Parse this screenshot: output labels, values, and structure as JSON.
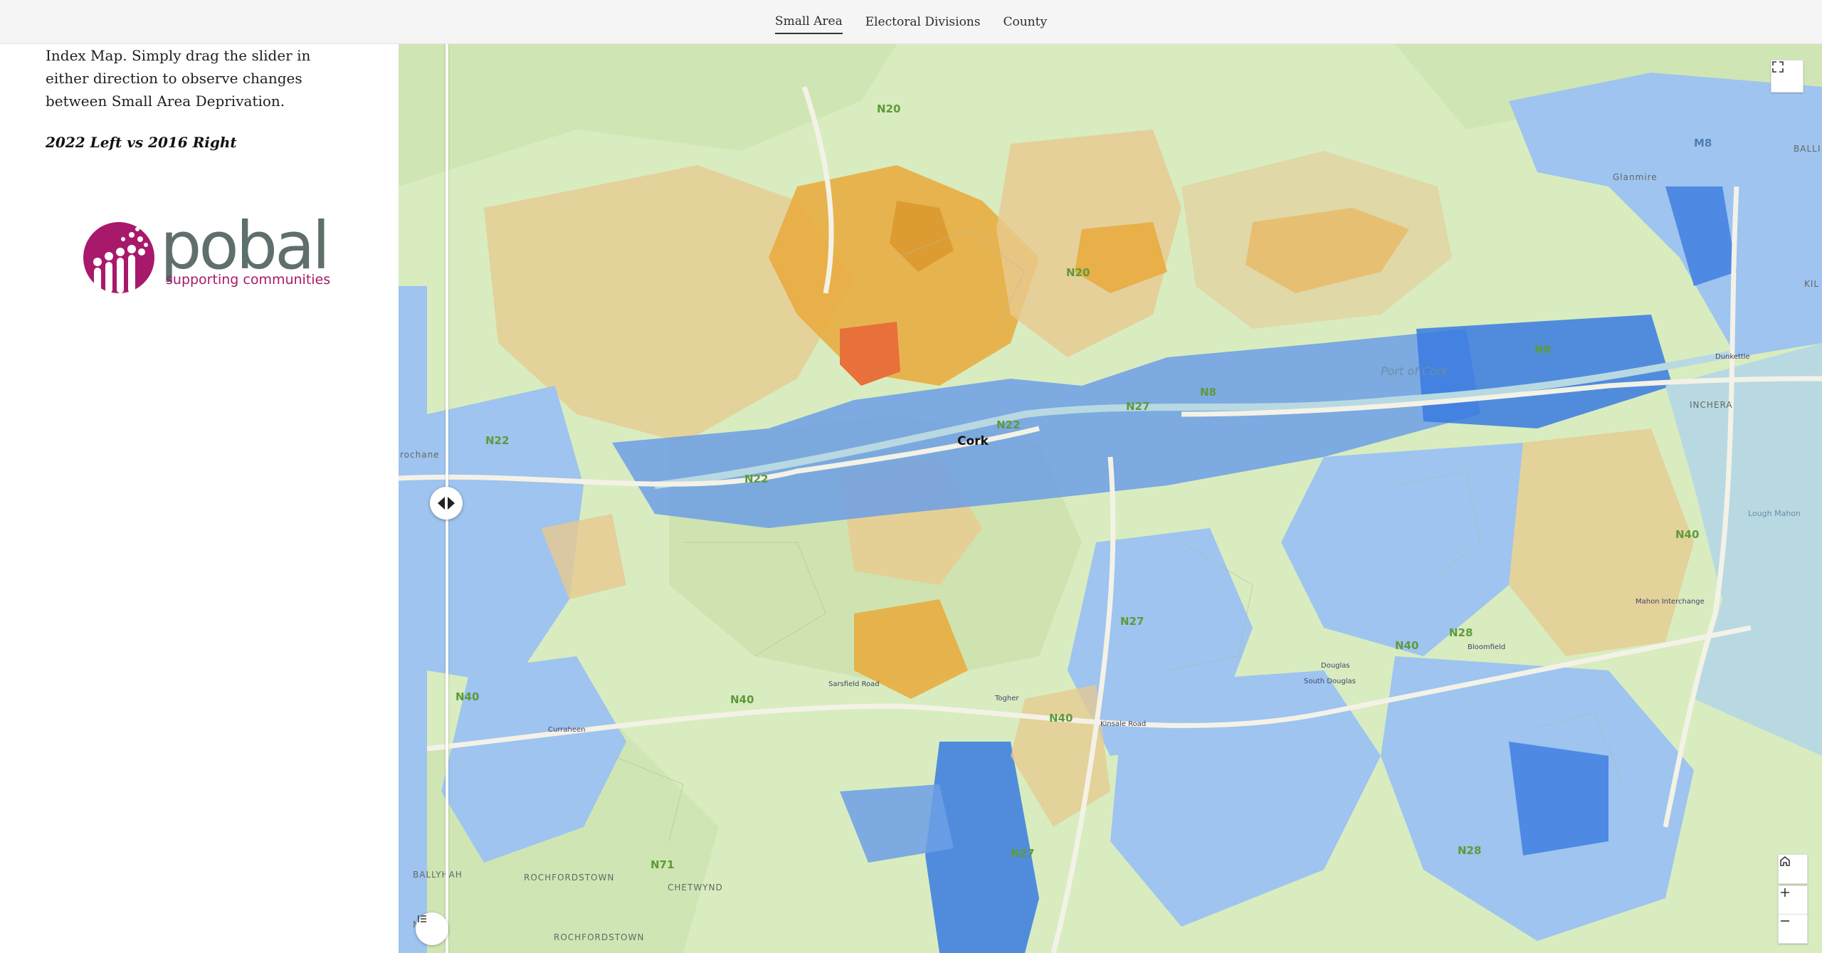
{
  "nav": {
    "tabs": [
      {
        "label": "Small Area",
        "active": true
      },
      {
        "label": "Electoral Divisions",
        "active": false
      },
      {
        "label": "County",
        "active": false
      }
    ]
  },
  "sidebar": {
    "intro": "Index Map. Simply drag the slider in either direction to observe changes between Small Area Deprivation.",
    "subtitle": "2022 Left vs 2016 Right",
    "logo": {
      "word": "pobal",
      "tagline": "supporting communities",
      "color": "#a8196b",
      "text_color": "#5e6f6e"
    }
  },
  "map": {
    "city": "Cork",
    "places": [
      {
        "name": "Glanmire"
      },
      {
        "name": "INCHERA"
      },
      {
        "name": "BALLYHAH"
      },
      {
        "name": "ROCHFORDSTOWN"
      },
      {
        "name": "CHETWYND"
      },
      {
        "name": "ROCHFORDSTOWN"
      },
      {
        "name": "BALLI"
      },
      {
        "name": "KIL"
      },
      {
        "name": "MAH"
      },
      {
        "name": "rochane"
      }
    ],
    "water": {
      "port": "Port of Cork",
      "lough": "Lough Mahon"
    },
    "roads": [
      "N20",
      "N20",
      "N22",
      "N22",
      "N22",
      "N27",
      "N27",
      "N27",
      "N8",
      "N8",
      "N40",
      "N40",
      "N40",
      "N40",
      "N40",
      "N28",
      "N28",
      "N71",
      "M8"
    ],
    "junctions": [
      "Sarsfield Road",
      "Togher",
      "Kinsale Road",
      "Douglas",
      "South Douglas",
      "Bloomfield",
      "Mahon Interchange",
      "Dunkettle",
      "Curraheen"
    ],
    "colors": {
      "land": "#d8ecc0",
      "orange": "#eaa93a",
      "tan": "#e8c98f",
      "light_blue": "#9ec4ef",
      "blue": "#6c9fe6",
      "dark_blue": "#3a7be0",
      "red": "#e8703a",
      "water": "#b8d9e2"
    }
  },
  "widgets": {
    "expand": "expand-icon",
    "home": "home-icon",
    "zoom_in": "plus-icon",
    "zoom_out": "minus-icon",
    "legend": "legend-icon",
    "swipe": "swipe-handle"
  }
}
